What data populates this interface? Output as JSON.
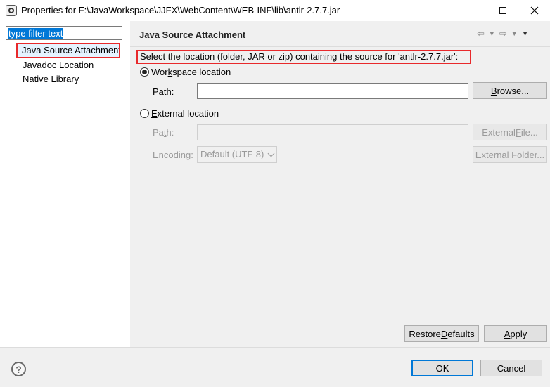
{
  "window": {
    "title": "Properties for F:\\JavaWorkspace\\JJFX\\WebContent\\WEB-INF\\lib\\antlr-2.7.7.jar",
    "minimize_icon": "minimize-icon",
    "maximize_icon": "maximize-icon",
    "close_icon": "close-icon"
  },
  "sidebar": {
    "filter_placeholder": "type filter text",
    "filter_value": "type filter text",
    "items": [
      {
        "label": "Java Source Attachment",
        "selected": true
      },
      {
        "label": "Javadoc Location",
        "selected": false
      },
      {
        "label": "Native Library",
        "selected": false
      }
    ]
  },
  "page": {
    "title": "Java Source Attachment",
    "description": "Select the location (folder, JAR or zip) containing the source for 'antlr-2.7.7.jar':",
    "workspace_option": {
      "label_prefix": "Wor",
      "label_mnemonic": "k",
      "label_suffix": "space location",
      "selected": true,
      "path_label_mnemonic": "P",
      "path_label_suffix": "ath:",
      "path_value": "",
      "browse_prefix": "",
      "browse_mnemonic": "B",
      "browse_suffix": "rowse..."
    },
    "external_option": {
      "label_prefix": "",
      "label_mnemonic": "E",
      "label_suffix": "xternal location",
      "selected": false,
      "path_label_prefix": "Pa",
      "path_label_mnemonic": "t",
      "path_label_suffix": "h:",
      "path_value": "",
      "encoding_label_prefix": "En",
      "encoding_label_mnemonic": "c",
      "encoding_label_suffix": "oding:",
      "encoding_value": "Default (UTF-8)",
      "external_file_prefix": "External ",
      "external_file_mnemonic": "F",
      "external_file_suffix": "ile...",
      "external_folder_prefix": "External F",
      "external_folder_mnemonic": "o",
      "external_folder_suffix": "lder..."
    },
    "restore_defaults_prefix": "Restore ",
    "restore_defaults_mnemonic": "D",
    "restore_defaults_suffix": "efaults",
    "apply_prefix": "",
    "apply_mnemonic": "A",
    "apply_suffix": "pply"
  },
  "footer": {
    "help_glyph": "?",
    "ok_label": "OK",
    "cancel_label": "Cancel"
  },
  "colors": {
    "highlight_border": "#e8292b",
    "selection": "#0078d7",
    "panel_bg": "#f0f0f0"
  }
}
